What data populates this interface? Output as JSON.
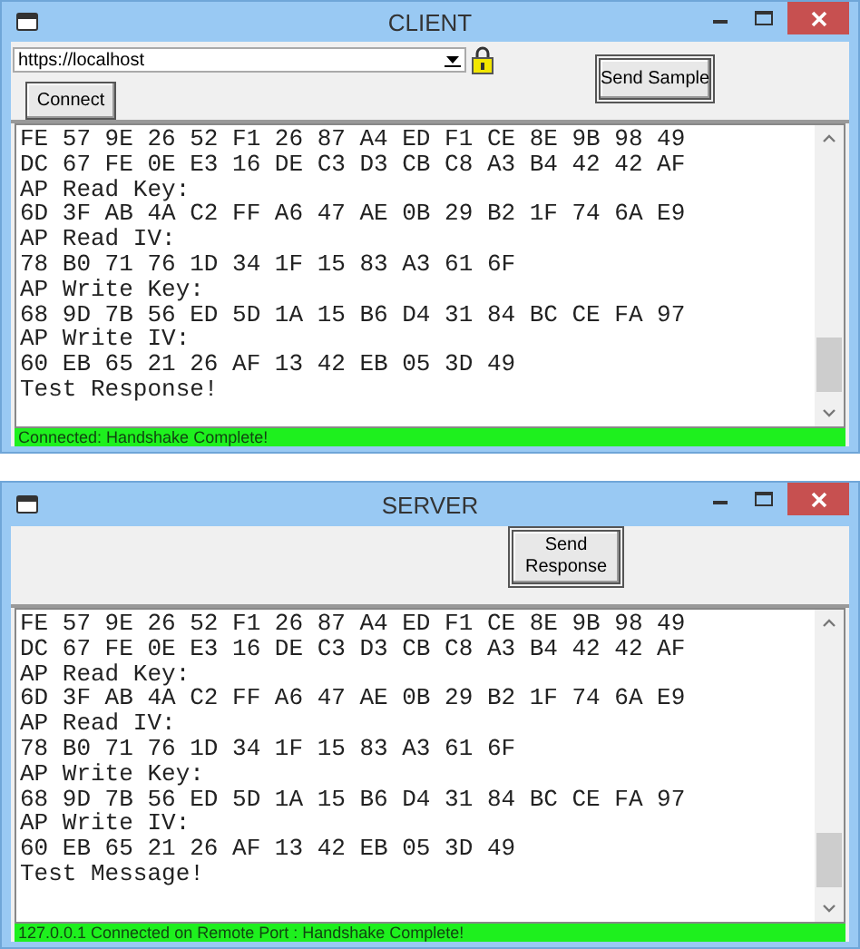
{
  "windows": [
    {
      "title": "CLIENT",
      "address": {
        "value": "https://localhost",
        "secure": true
      },
      "connect_button": "Connect",
      "send_button": "Send Sample",
      "log": [
        "FE 57 9E 26 52 F1 26 87 A4 ED F1 CE 8E 9B 98 49",
        "DC 67 FE 0E E3 16 DE C3 D3 CB C8 A3 B4 42 42 AF",
        "AP Read Key:",
        "6D 3F AB 4A C2 FF A6 47 AE 0B 29 B2 1F 74 6A E9",
        "AP Read IV:",
        "78 B0 71 76 1D 34 1F 15 83 A3 61 6F",
        "AP Write Key:",
        "68 9D 7B 56 ED 5D 1A 15 B6 D4 31 84 BC CE FA 97",
        "AP Write IV:",
        "60 EB 65 21 26 AF 13 42 EB 05 3D 49",
        "Test Response!"
      ],
      "status": "Connected: Handshake Complete!"
    },
    {
      "title": "SERVER",
      "send_button": "Send Response",
      "log": [
        "FE 57 9E 26 52 F1 26 87 A4 ED F1 CE 8E 9B 98 49",
        "DC 67 FE 0E E3 16 DE C3 D3 CB C8 A3 B4 42 42 AF",
        "AP Read Key:",
        "6D 3F AB 4A C2 FF A6 47 AE 0B 29 B2 1F 74 6A E9",
        "AP Read IV:",
        "78 B0 71 76 1D 34 1F 15 83 A3 61 6F",
        "AP Write Key:",
        "68 9D 7B 56 ED 5D 1A 15 B6 D4 31 84 BC CE FA 97",
        "AP Write IV:",
        "60 EB 65 21 26 AF 13 42 EB 05 3D 49",
        "Test Message!"
      ],
      "status": "127.0.0.1 Connected on Remote Port : Handshake Complete!"
    }
  ]
}
